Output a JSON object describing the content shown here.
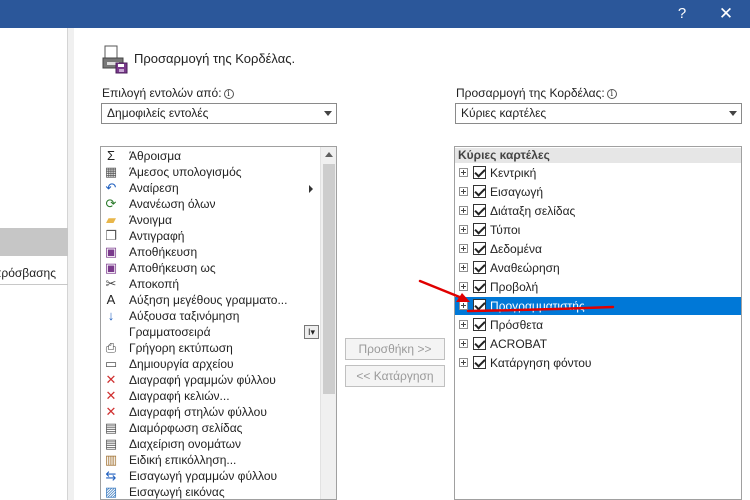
{
  "window": {
    "help_glyph": "?",
    "close_glyph": "✕"
  },
  "left_nav": {
    "partial_label": "πρόσβασης"
  },
  "header": {
    "title": "Προσαρμογή της Κορδέλας."
  },
  "left_panel": {
    "choose_label": "Επιλογή εντολών από:",
    "choose_value": "Δημοφιλείς εντολές",
    "commands": [
      {
        "label": "Άθροισμα",
        "icon": "sum-icon"
      },
      {
        "label": "Άμεσος υπολογισμός",
        "icon": "calculator-icon"
      },
      {
        "label": "Αναίρεση",
        "icon": "undo-icon"
      },
      {
        "label": "Ανανέωση όλων",
        "icon": "refresh-icon"
      },
      {
        "label": "Άνοιγμα",
        "icon": "folder-open-icon"
      },
      {
        "label": "Αντιγραφή",
        "icon": "copy-icon"
      },
      {
        "label": "Αποθήκευση",
        "icon": "save-icon"
      },
      {
        "label": "Αποθήκευση ως",
        "icon": "save-as-icon"
      },
      {
        "label": "Αποκοπή",
        "icon": "cut-icon"
      },
      {
        "label": "Αύξηση μεγέθους γραμματο...",
        "icon": "font-grow-icon"
      },
      {
        "label": "Αύξουσα ταξινόμηση",
        "icon": "sort-ascending-icon"
      },
      {
        "label": "Γραμματοσειρά",
        "icon": "font-icon"
      },
      {
        "label": "Γρήγορη εκτύπωση",
        "icon": "quick-print-icon"
      },
      {
        "label": "Δημιουργία αρχείου",
        "icon": "new-file-icon"
      },
      {
        "label": "Διαγραφή γραμμών φύλλου",
        "icon": "delete-rows-icon"
      },
      {
        "label": "Διαγραφή κελιών...",
        "icon": "delete-cells-icon"
      },
      {
        "label": "Διαγραφή στηλών φύλλου",
        "icon": "delete-columns-icon"
      },
      {
        "label": "Διαμόρφωση σελίδας",
        "icon": "page-setup-icon"
      },
      {
        "label": "Διαχείριση ονομάτων",
        "icon": "name-manager-icon"
      },
      {
        "label": "Ειδική επικόλληση...",
        "icon": "paste-special-icon"
      },
      {
        "label": "Εισαγωγή γραμμών φύλλου",
        "icon": "insert-rows-icon"
      },
      {
        "label": "Εισαγωγή εικόνας",
        "icon": "insert-picture-icon"
      }
    ]
  },
  "buttons": {
    "add": "Προσθήκη >>",
    "remove": "<< Κατάργηση"
  },
  "right_panel": {
    "customize_label": "Προσαρμογή της Κορδέλας:",
    "customize_value": "Κύριες καρτέλες",
    "tree_header": "Κύριες καρτέλες",
    "tabs": [
      "Κεντρική",
      "Εισαγωγή",
      "Διάταξη σελίδας",
      "Τύποι",
      "Δεδομένα",
      "Αναθεώρηση",
      "Προβολή",
      "Προγραμματιστής",
      "Πρόσθετα",
      "ACROBAT",
      "Κατάργηση φόντου"
    ],
    "selected_tab": "Προγραμματιστής"
  },
  "colors": {
    "titlebar": "#2b579a",
    "selection": "#0078d7",
    "annotation": "#e00000"
  }
}
